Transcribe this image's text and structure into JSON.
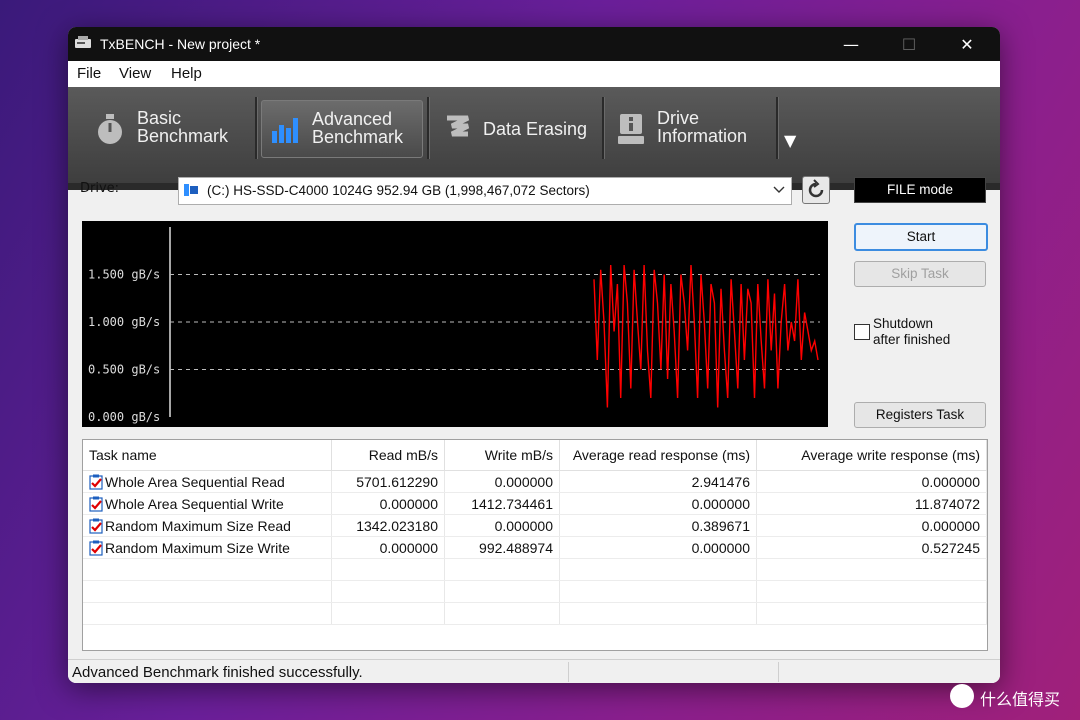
{
  "window": {
    "title": "TxBENCH - New project *",
    "controls": {
      "minimize": "—",
      "maximize": "☐",
      "close": "✕"
    }
  },
  "menu": {
    "items": [
      "File",
      "View",
      "Help"
    ]
  },
  "ribbon": {
    "tabs": [
      {
        "line1": "Basic",
        "line2": "Benchmark",
        "icon": "stopwatch-icon",
        "active": false
      },
      {
        "line1": "Advanced",
        "line2": "Benchmark",
        "icon": "bar-chart-icon",
        "active": true
      },
      {
        "line1": "Data Erasing",
        "line2": "",
        "icon": "eraser-icon",
        "active": false
      },
      {
        "line1": "Drive",
        "line2": "Information",
        "icon": "drive-info-icon",
        "active": false
      }
    ],
    "more_icon": "▼"
  },
  "drive": {
    "label": "Drive:",
    "selected": "(C:) HS-SSD-C4000 1024G  952.94 GB (1,998,467,072 Sectors)"
  },
  "mode": "FILE mode",
  "buttons": {
    "start": "Start",
    "skip_task": "Skip Task",
    "registers_task": "Registers Task"
  },
  "shutdown": {
    "line1": "Shutdown",
    "line2": "after finished",
    "checked": false
  },
  "chart_data": {
    "type": "line",
    "yticks": [
      "0.000 gB/s",
      "0.500 gB/s",
      "1.000 gB/s",
      "1.500 gB/s"
    ],
    "ylim": [
      0,
      2.0
    ],
    "series_color": "#ff0000",
    "series": [
      {
        "values": [
          1.45,
          0.6,
          1.55,
          1.0,
          0.1,
          1.6,
          0.9,
          1.4,
          0.2,
          1.6,
          1.2,
          0.3,
          1.55,
          1.0,
          0.5,
          1.6,
          0.7,
          0.2,
          1.55,
          1.2,
          0.5,
          1.5,
          0.4,
          1.4,
          0.9,
          0.2,
          1.5,
          1.2,
          0.7,
          1.6,
          1.0,
          0.2,
          1.5,
          1.0,
          0.3,
          1.4,
          1.2,
          0.1,
          1.35,
          0.7,
          0.2,
          1.45,
          0.9,
          0.3,
          1.4,
          0.6,
          1.35,
          1.2,
          0.2,
          1.4,
          0.8,
          0.3,
          1.45,
          0.7,
          1.3,
          0.3,
          1.0,
          1.4,
          0.7,
          1.0,
          0.8,
          1.45,
          0.6,
          1.1,
          0.9,
          0.7,
          0.8,
          0.6
        ]
      }
    ]
  },
  "table": {
    "headers": [
      "Task name",
      "Read mB/s",
      "Write mB/s",
      "Average read response (ms)",
      "Average write response (ms)"
    ],
    "rows": [
      [
        "Whole Area Sequential Read",
        "5701.612290",
        "0.000000",
        "2.941476",
        "0.000000"
      ],
      [
        "Whole Area Sequential Write",
        "0.000000",
        "1412.734461",
        "0.000000",
        "11.874072"
      ],
      [
        "Random Maximum Size Read",
        "1342.023180",
        "0.000000",
        "0.389671",
        "0.000000"
      ],
      [
        "Random Maximum Size Write",
        "0.000000",
        "992.488974",
        "0.000000",
        "0.527245"
      ]
    ]
  },
  "status": "Advanced Benchmark finished successfully.",
  "watermark": "什么值得买"
}
